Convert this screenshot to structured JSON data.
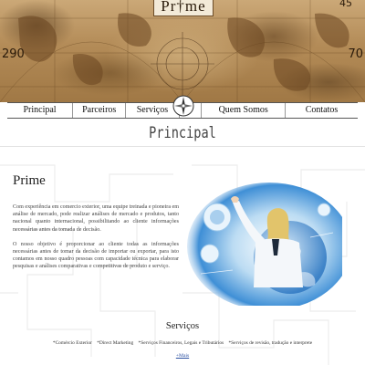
{
  "header": {
    "logo_text": "Pr†me",
    "degree_left": "290",
    "degree_right": "70",
    "degree_top": "45"
  },
  "nav": {
    "items": [
      {
        "label": "Principal"
      },
      {
        "label": "Parceiros"
      },
      {
        "label": "Serviços"
      },
      {
        "label": "Quem Somos"
      },
      {
        "label": "Contatos"
      }
    ]
  },
  "page": {
    "title": "Principal"
  },
  "content": {
    "heading": "Prime",
    "paragraph_1": "Com experiência em comercio exterior, uma equipe treinada e pioneira em análise de mercado, pode realizar análises de mercado e produtos, tanto nacional quanto internacional, possibilitando ao cliente informações necessárias antes da tomada de decisão.",
    "paragraph_2": "O nosso objetivo é proporcionar ao cliente todas as informações necessárias antes de tomar da decisão de importar ou exportar, para isto contamos em nosso quadro pessoas com capacidade técnica para elaborar pesquisas e análises comparativas e competitivas de produto e serviço."
  },
  "services": {
    "title": "Serviços",
    "items": [
      "*Comércio Exterior",
      "*Direct Marketing",
      "*Serviços Financeiros, Legais e Tributários",
      "*Serviços de revisão, tradução e interprete"
    ],
    "more_link": "+Mais"
  },
  "colors": {
    "map_base": "#b38b57",
    "link": "#2a4fa0",
    "hero_blue": "#3f8fd6"
  }
}
